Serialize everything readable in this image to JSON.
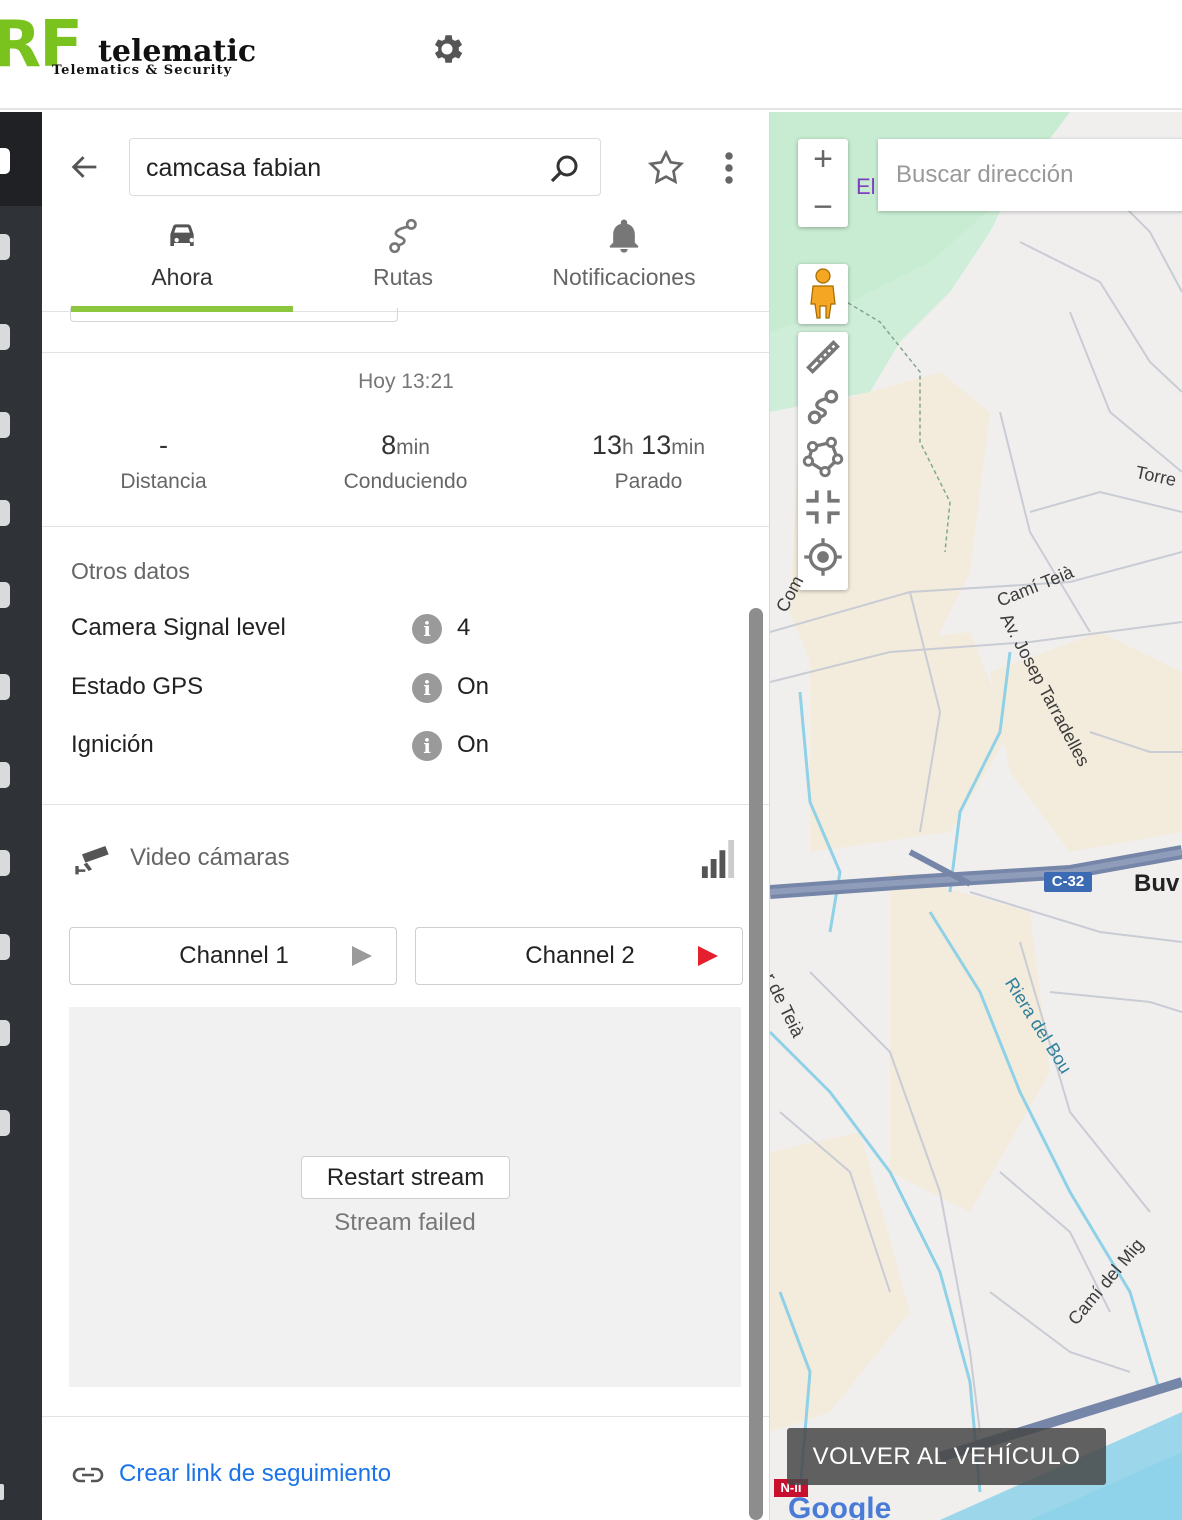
{
  "header": {
    "logo_main": "RF",
    "logo_word": "telematic",
    "logo_sub": "Telematics & Security",
    "settings_icon": "gear-icon"
  },
  "panel": {
    "search_value": "camcasa fabian",
    "tabs": [
      {
        "label": "Ahora",
        "icon": "car-icon",
        "active": true
      },
      {
        "label": "Rutas",
        "icon": "route-icon",
        "active": false
      },
      {
        "label": "Notificaciones",
        "icon": "bell-icon",
        "active": false
      }
    ],
    "time": "Hoy 13:21",
    "stats": {
      "distance": {
        "value": "-",
        "label": "Distancia"
      },
      "driving": {
        "value": "8",
        "unit": "min",
        "label": "Conduciendo"
      },
      "stopped": {
        "hours": "13",
        "h_unit": "h",
        "minutes": "13",
        "m_unit": "min",
        "label": "Parado"
      }
    },
    "other_data": {
      "title": "Otros datos",
      "rows": [
        {
          "label": "Camera Signal level",
          "value": "4"
        },
        {
          "label": "Estado GPS",
          "value": "On"
        },
        {
          "label": "Ignición",
          "value": "On"
        }
      ]
    },
    "video": {
      "title": "Video cámaras",
      "channels": [
        {
          "label": "Channel 1",
          "play_color": "#9a9a9a"
        },
        {
          "label": "Channel 2",
          "play_color": "#e4202e"
        }
      ],
      "restart_label": "Restart stream",
      "status": "Stream failed"
    },
    "tracking_link": "Crear link de seguimiento"
  },
  "map": {
    "address_placeholder": "Buscar dirección",
    "zoom_in": "+",
    "zoom_out": "−",
    "labels": {
      "el": "El",
      "torre": "Torre",
      "cami_teia": "Camí Teià",
      "av_josep": "Av. Josep Tarradelles",
      "com": "Com",
      "c32": "C-32",
      "buv": "Buv",
      "de_teia": "r de Teià",
      "riera": "Riera del Bou",
      "cami_mig": "Camí del Mig",
      "nii": "N-II"
    },
    "back_to_vehicle": "VOLVER AL VEHÍCULO",
    "google": "Google"
  },
  "colors": {
    "accent": "#8cc63f",
    "link": "#1a73e8",
    "alert": "#e4202e",
    "rail": "#2f3236"
  }
}
